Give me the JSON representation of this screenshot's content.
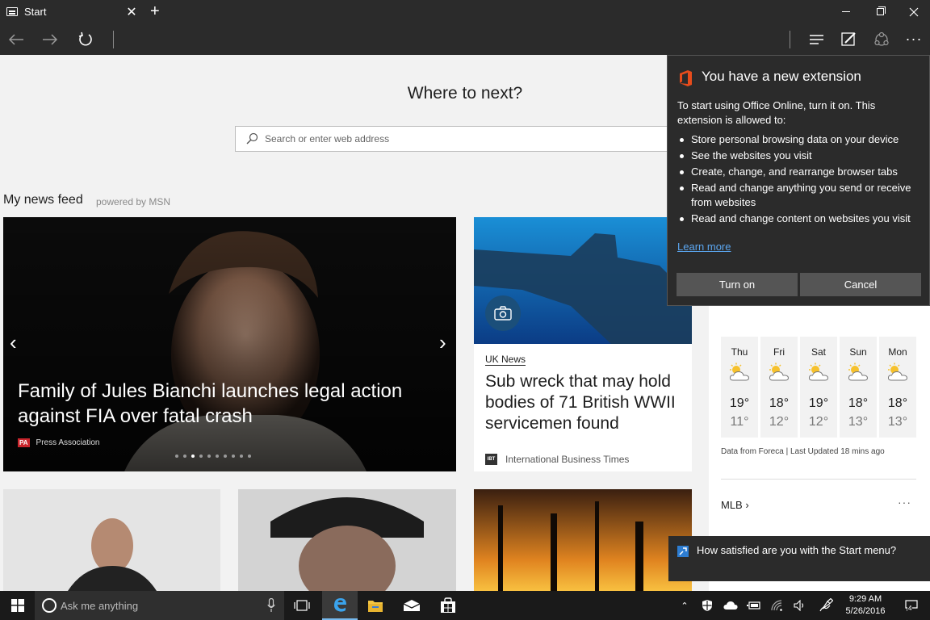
{
  "browser": {
    "tab_title": "Start",
    "tab_close": "✕",
    "new_tab": "+",
    "more": "···"
  },
  "start_page": {
    "heading": "Where to next?",
    "search_placeholder": "Search or enter web address",
    "feed_title": "My news feed",
    "feed_powered": "powered by MSN"
  },
  "hero": {
    "title": "Family of Jules Bianchi launches legal action against FIA over fatal crash",
    "source_logo": "PA",
    "source": "Press Association",
    "dots_total": 10,
    "dots_active_index": 2,
    "prev": "‹",
    "next": "›"
  },
  "card2": {
    "category": "UK News",
    "title": "Sub wreck that may hold bodies of 71 British WWII servicemen found",
    "source_logo": "IBT",
    "source": "International Business Times"
  },
  "weather": {
    "days": [
      {
        "name": "Thu",
        "hi": "19°",
        "lo": "11°"
      },
      {
        "name": "Fri",
        "hi": "18°",
        "lo": "12°"
      },
      {
        "name": "Sat",
        "hi": "19°",
        "lo": "12°"
      },
      {
        "name": "Sun",
        "hi": "18°",
        "lo": "13°"
      },
      {
        "name": "Mon",
        "hi": "18°",
        "lo": "13°"
      }
    ],
    "credit": "Data from Foreca | Last Updated 18 mins ago"
  },
  "mlb": {
    "label": "MLB ›",
    "more": "···"
  },
  "extension_popup": {
    "title": "You have a new extension",
    "intro": "To start using Office Online, turn it on. This extension is allowed to:",
    "permissions": [
      "Store personal browsing data on your device",
      "See the websites you visit",
      "Create, change, and rearrange browser tabs",
      "Read and change anything you send or receive from websites",
      "Read and change content on websites you visit"
    ],
    "learn_more": "Learn more",
    "turn_on": "Turn on",
    "cancel": "Cancel"
  },
  "toast": {
    "text": "How satisfied are you with the Start menu?"
  },
  "taskbar": {
    "cortana_placeholder": "Ask me anything",
    "time": "9:29 AM",
    "date": "5/26/2016",
    "notifications_count": "4",
    "tray_up": "⌃"
  },
  "colors": {
    "chrome": "#2b2b2b",
    "taskbar": "#1a1a1a",
    "accent": "#76b9ed",
    "link": "#5ba6f0",
    "office": "#e74c1c"
  }
}
